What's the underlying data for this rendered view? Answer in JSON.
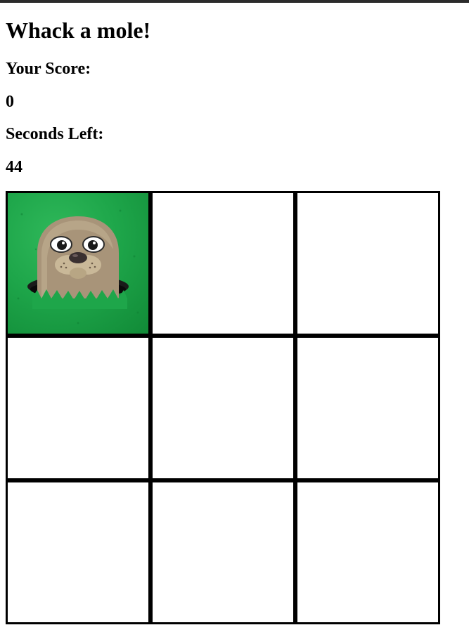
{
  "game": {
    "title": "Whack a mole!",
    "score_label": "Your Score:",
    "score_value": "0",
    "seconds_label": "Seconds Left:",
    "seconds_value": "44"
  },
  "board": {
    "rows": 3,
    "cols": 3,
    "active_hole": 1,
    "holes": [
      {
        "id": 1,
        "has_mole": true
      },
      {
        "id": 2,
        "has_mole": false
      },
      {
        "id": 3,
        "has_mole": false
      },
      {
        "id": 4,
        "has_mole": false
      },
      {
        "id": 5,
        "has_mole": false
      },
      {
        "id": 6,
        "has_mole": false
      },
      {
        "id": 7,
        "has_mole": false
      },
      {
        "id": 8,
        "has_mole": false
      },
      {
        "id": 9,
        "has_mole": false
      }
    ]
  },
  "colors": {
    "grass": "#1ea64a",
    "mole_body": "#a89479",
    "cell_border": "#000000",
    "top_bar": "#2b2b2b"
  }
}
